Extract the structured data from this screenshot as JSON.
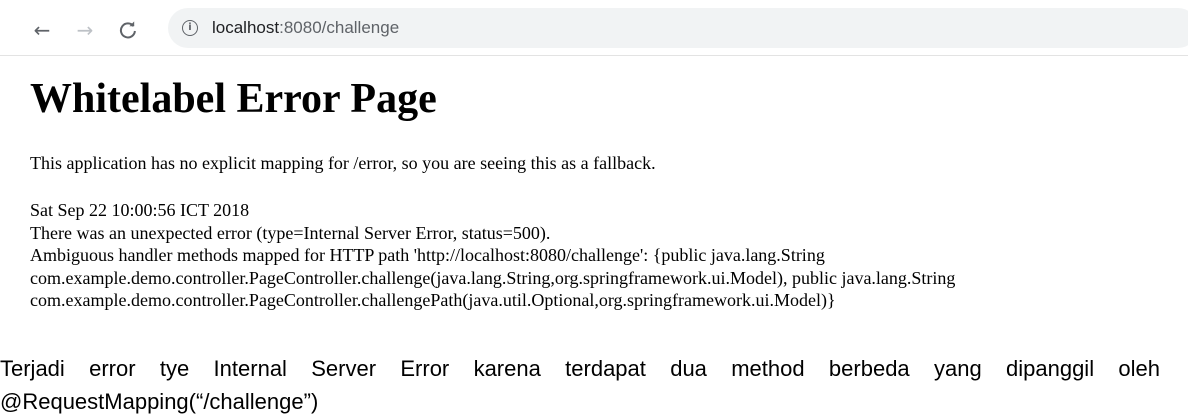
{
  "browser": {
    "back_icon": "arrow-left-icon",
    "forward_icon": "arrow-right-icon",
    "reload_icon": "reload-icon",
    "info_icon": "info-circle-icon",
    "url_host": "localhost",
    "url_rest": ":8080/challenge"
  },
  "page": {
    "title": "Whitelabel Error Page",
    "fallback": "This application has no explicit mapping for /error, so you are seeing this as a fallback.",
    "timestamp": "Sat Sep 22 10:00:56 ICT 2018",
    "error_summary": "There was an unexpected error (type=Internal Server Error, status=500).",
    "detail_lines": [
      "Ambiguous handler methods mapped for HTTP path 'http://localhost:8080/challenge': {public java.lang.String",
      "com.example.demo.controller.PageController.challenge(java.lang.String,org.springframework.ui.Model), public java.lang.String",
      "com.example.demo.controller.PageController.challengePath(java.util.Optional,org.springframework.ui.Model)}"
    ]
  },
  "caption": "Terjadi error tye Internal Server Error karena terdapat dua method berbeda yang dipanggil oleh @RequestMapping(“/challenge”)"
}
